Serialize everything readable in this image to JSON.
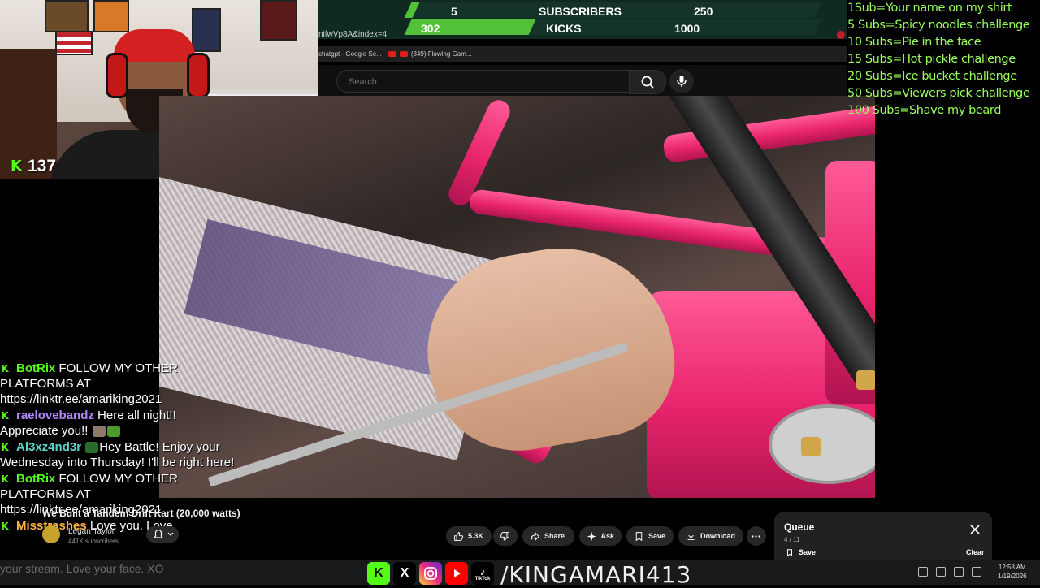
{
  "goals": {
    "subscribers": {
      "current": "5",
      "label": "SUBSCRIBERS",
      "target": "250",
      "progress": 0.02
    },
    "kicks": {
      "current": "302",
      "label": "KICKS",
      "target": "1000",
      "progress": 0.302
    }
  },
  "browser": {
    "url_fragment": "nifwVp8A&index=4",
    "bookmarks": [
      "chatgpt - Google Se...",
      "(349) Flowing Gam..."
    ]
  },
  "stream": {
    "kick_viewers": "137"
  },
  "youtube": {
    "search_placeholder": "Search",
    "video_title": "We Built a Tandem Drift Kart (20,000 watts)",
    "channel_name": "Legan Taylor",
    "channel_subs": "441K subscribers",
    "actions": {
      "likes": "5.3K",
      "share": "Share",
      "ask": "Ask",
      "save": "Save",
      "download": "Download"
    },
    "queue": {
      "title": "Queue",
      "count": "4 / 11",
      "save": "Save",
      "clear": "Clear"
    }
  },
  "chat": [
    {
      "user": "BotRix",
      "color": "#53fc18",
      "text": "FOLLOW MY OTHER PLATFORMS AT https://linktr.ee/amariking2021"
    },
    {
      "user": "raelovebandz",
      "color": "#b088ff",
      "text": "Here all night!! Appreciate you!!"
    },
    {
      "user": "Al3xz4nd3r",
      "color": "#5fd3c8",
      "text": "Hey Battle! Enjoy your Wednesday into Thursday! I'll be right here!"
    },
    {
      "user": "BotRix",
      "color": "#53fc18",
      "text": "FOLLOW MY OTHER PLATFORMS AT https://linktr.ee/amariking2021"
    },
    {
      "user": "Misstrashes",
      "color": "#ffb347",
      "text": "Love you. Love"
    }
  ],
  "chat_tail": "your stream. Love your face. XO",
  "sub_goals": [
    "1Sub=Your name on my shirt",
    "5 Subs=Spicy noodles challenge",
    "10 Subs=Pie in the face",
    "15 Subs=Hot pickle challenge",
    "20 Subs=Ice bucket challenge",
    "50 Subs=Viewers pick challenge",
    "100 Subs=Shave my beard"
  ],
  "socials": {
    "handle": "/KINGAMARI413",
    "tiktok_label": "TikTok"
  },
  "clock": {
    "time": "12:58 AM",
    "date": "1/19/2026"
  },
  "colors": {
    "kick_green": "#53fc18",
    "subgoal_text": "#9aff5e",
    "goal_bg": "#0f2a20"
  }
}
